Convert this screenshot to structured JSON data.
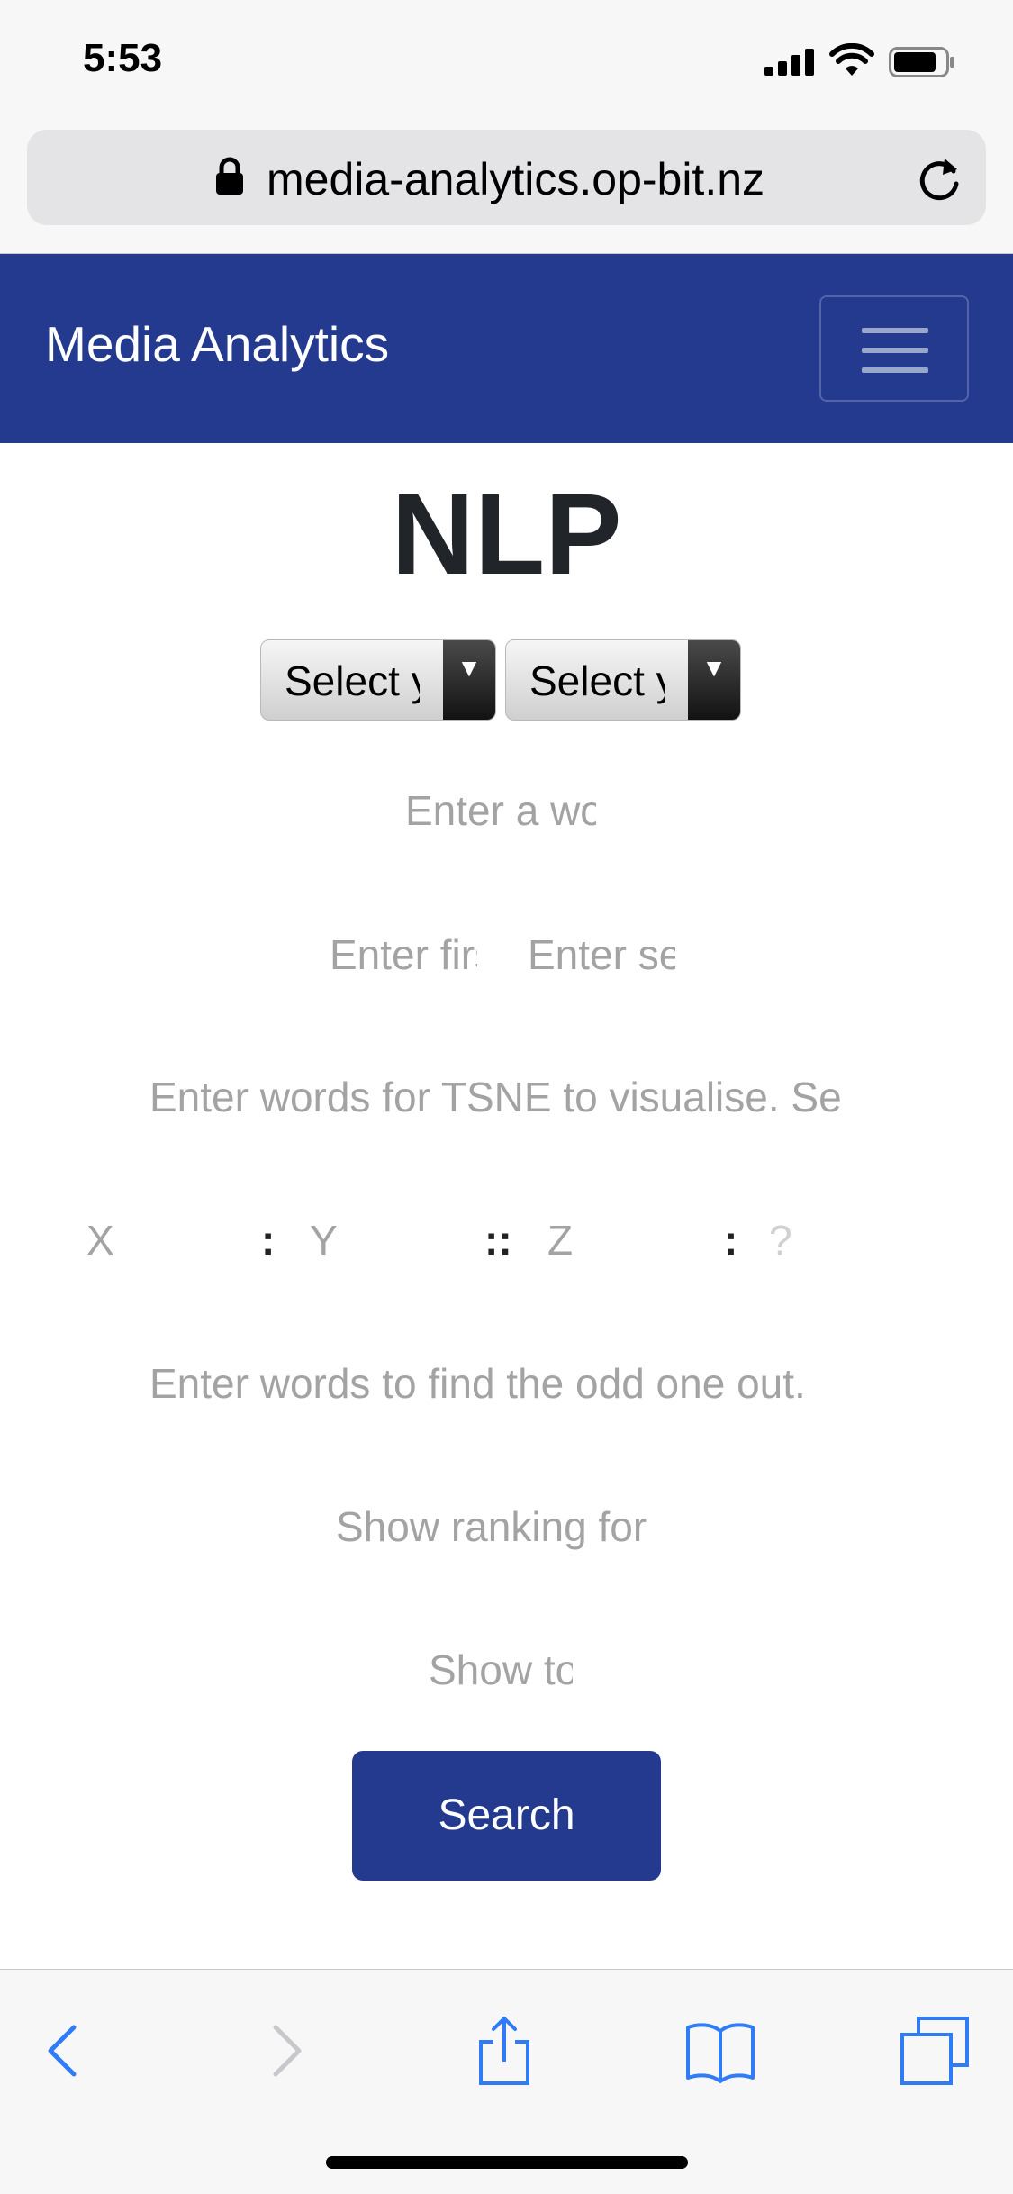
{
  "status_bar": {
    "time": "5:53"
  },
  "browser": {
    "url": "media-analytics.op-bit.nz"
  },
  "navbar": {
    "brand": "Media Analytics"
  },
  "page": {
    "title": "NLP",
    "selects": [
      {
        "value": "Select y"
      },
      {
        "value": "Select y"
      }
    ],
    "fields": {
      "word_placeholder": "Enter a word",
      "first_placeholder": "Enter first",
      "second_placeholder": "Enter second",
      "tsne_placeholder": "Enter words for TSNE to visualise. Se",
      "analogy_x": "X",
      "analogy_y": "Y",
      "analogy_z": "Z",
      "analogy_q": "?",
      "odd_placeholder": "Enter words to find the odd one out.",
      "ranking_placeholder": "Show ranking for",
      "show_top_placeholder": "Show to"
    },
    "analogy_colons": [
      ":",
      "::",
      ":"
    ],
    "search_label": "Search"
  },
  "colors": {
    "primary": "#233a8e",
    "toolbar_accent": "#2f7cf6"
  }
}
